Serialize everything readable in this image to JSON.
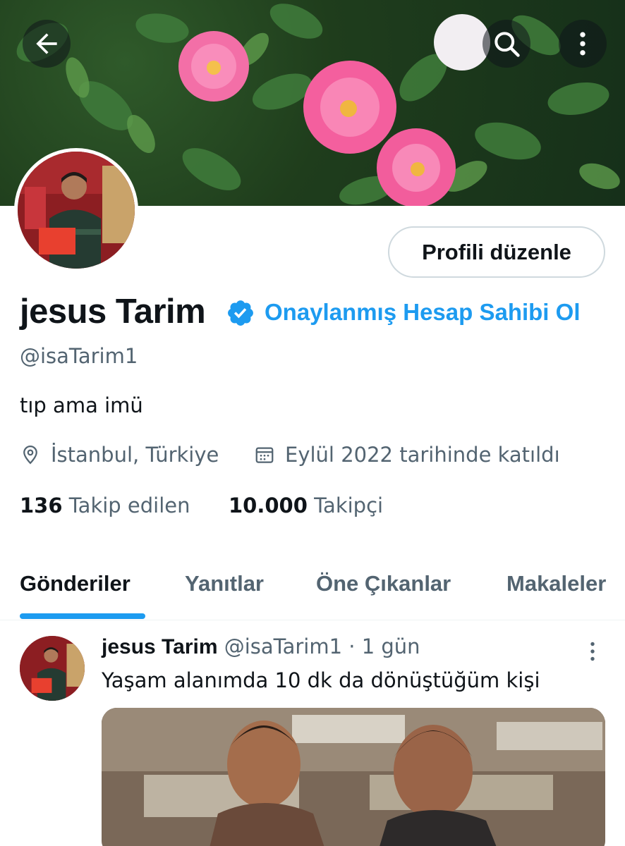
{
  "profile": {
    "display_name": "jesus Tarim",
    "verify_cta": "Onaylanmış Hesap Sahibi Ol",
    "handle": "@isaTarim1",
    "bio": "tıp ama imü",
    "location": "İstanbul, Türkiye",
    "joined": "Eylül 2022 tarihinde katıldı",
    "following_count": "136",
    "following_label": "Takip edilen",
    "followers_count": "10.000",
    "followers_label": "Takipçi",
    "edit_button": "Profili düzenle"
  },
  "topbar": {
    "icons": [
      "back-arrow-icon",
      "search-icon",
      "more-vertical-icon"
    ]
  },
  "tabs": [
    {
      "label": "Gönderiler",
      "active": true
    },
    {
      "label": "Yanıtlar",
      "active": false
    },
    {
      "label": "Öne Çıkanlar",
      "active": false
    },
    {
      "label": "Makaleler",
      "active": false
    }
  ],
  "post": {
    "author_name": "jesus Tarim",
    "author_handle": "@isaTarim1",
    "separator": "·",
    "time": "1 gün",
    "text": "Yaşam alanımda 10 dk da dönüştüğüm kişi"
  },
  "colors": {
    "accent": "#1d9bf0",
    "text_primary": "#0f1419",
    "text_secondary": "#536471",
    "border": "#cfd9de"
  }
}
